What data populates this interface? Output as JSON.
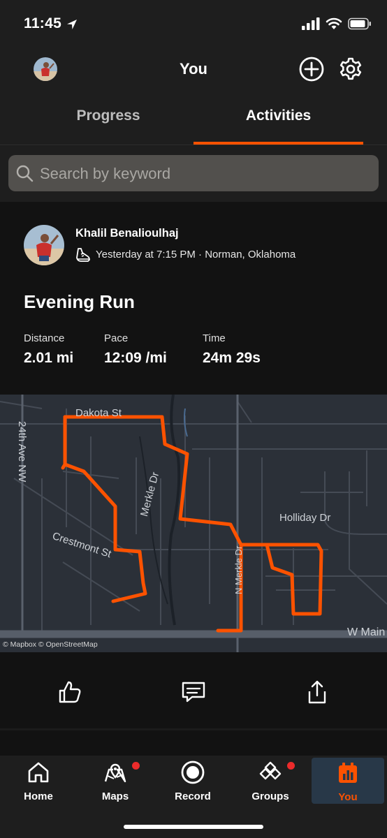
{
  "status_bar": {
    "time": "11:45"
  },
  "header": {
    "title": "You"
  },
  "tabs": [
    {
      "label": "Progress"
    },
    {
      "label": "Activities"
    }
  ],
  "search": {
    "placeholder": "Search by keyword"
  },
  "activity": {
    "athlete": "Khalil Benalioulhaj",
    "meta": "Yesterday at 7:15 PM · Norman, Oklahoma",
    "title": "Evening Run",
    "stats": [
      {
        "label": "Distance",
        "value": "2.01 mi"
      },
      {
        "label": "Pace",
        "value": "12:09 /mi"
      },
      {
        "label": "Time",
        "value": "24m 29s"
      }
    ],
    "map": {
      "attribution": "© Mapbox © OpenStreetMap",
      "streets": {
        "dakota": "Dakota St",
        "ave24": "24th Ave NW",
        "merkle": "Merkle Dr",
        "crestmont": "Crestmont St",
        "holliday": "Holliday Dr",
        "main": "W Main",
        "nmerkle": "N Merkle Dr"
      },
      "route_color": "#fc5200"
    }
  },
  "tabbar": {
    "items": [
      {
        "label": "Home",
        "icon": "home-icon"
      },
      {
        "label": "Maps",
        "icon": "map-icon",
        "badge": true
      },
      {
        "label": "Record",
        "icon": "record-icon"
      },
      {
        "label": "Groups",
        "icon": "groups-icon",
        "badge": true
      },
      {
        "label": "You",
        "icon": "you-icon",
        "active": true
      }
    ]
  },
  "colors": {
    "accent": "#fc5200",
    "badge": "#ec2b2b"
  }
}
